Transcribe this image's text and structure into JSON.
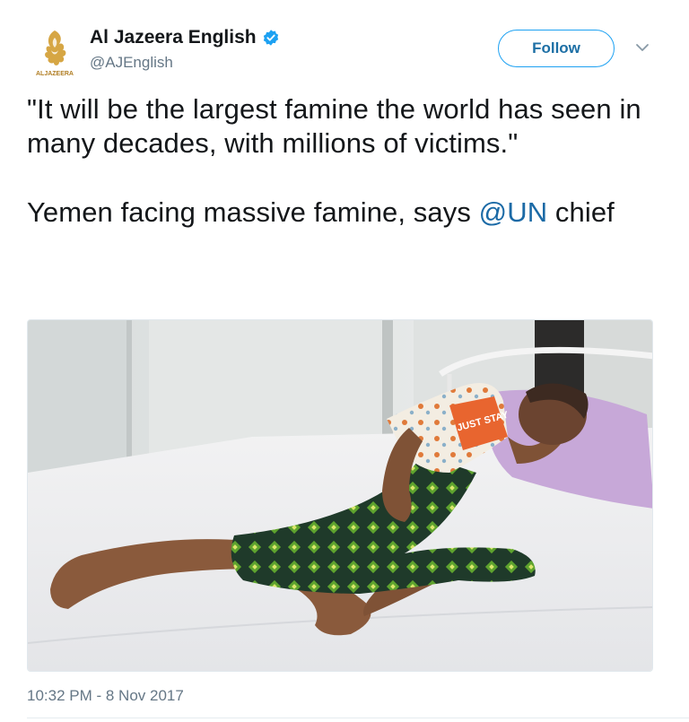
{
  "author": {
    "display_name": "Al Jazeera English",
    "handle": "@AJEnglish",
    "verified_icon": "verified-badge-icon",
    "avatar_logo_text": "ALJAZEERA"
  },
  "actions": {
    "follow_label": "Follow",
    "menu_icon": "chevron-down-icon"
  },
  "tweet": {
    "line1": "\"It will be the largest famine the world has seen in many decades, with millions of victims.\"",
    "line2_prefix": "Yemen facing massive famine, says ",
    "line2_mention": "@UN",
    "line2_suffix": " chief"
  },
  "media": {
    "shirt_print_text": "JUST STAY"
  },
  "meta": {
    "timestamp": "10:32 PM - 8 Nov 2017"
  },
  "colors": {
    "link": "#1b6aa6",
    "follow_border": "#1da1f2",
    "secondary_text": "#657786"
  }
}
